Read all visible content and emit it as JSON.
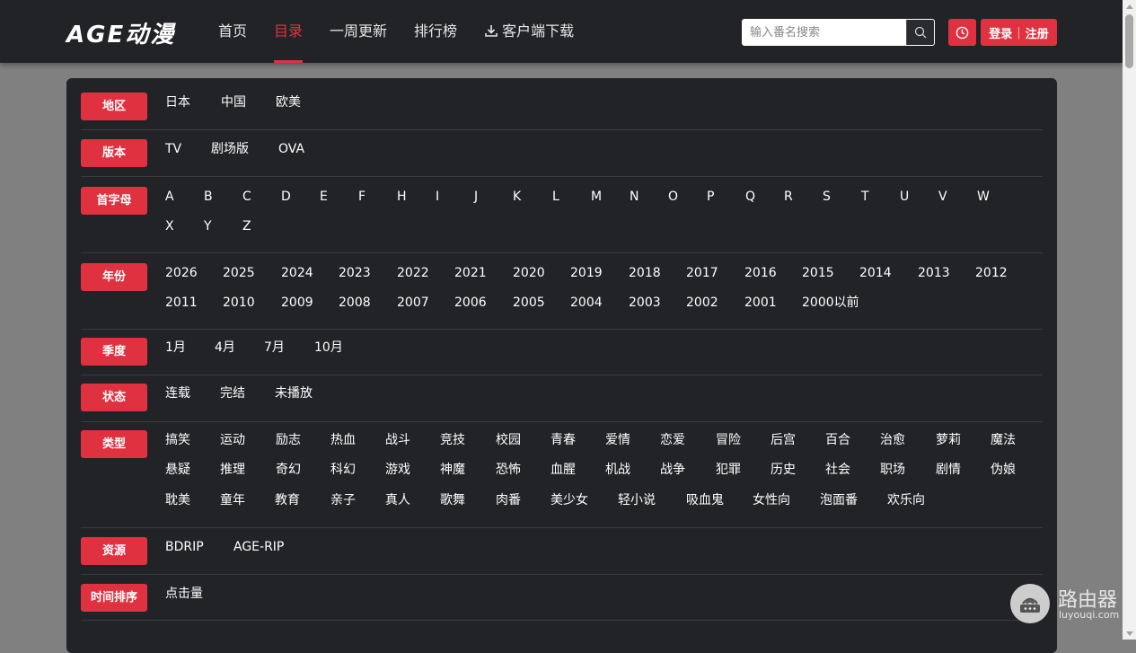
{
  "header": {
    "logo": "AGE动漫",
    "nav": [
      {
        "label": "首页",
        "active": false
      },
      {
        "label": "目录",
        "active": true
      },
      {
        "label": "一周更新",
        "active": false
      },
      {
        "label": "排行榜",
        "active": false
      },
      {
        "label": "客户端下载",
        "active": false
      }
    ],
    "search_placeholder": "输入番名搜索",
    "login_label": "登录",
    "register_label": "注册",
    "accent_color": "#e03141"
  },
  "filters": {
    "region": {
      "label": "地区",
      "items": [
        "日本",
        "中国",
        "欧美"
      ]
    },
    "version": {
      "label": "版本",
      "items": [
        "TV",
        "剧场版",
        "OVA"
      ]
    },
    "letter": {
      "label": "首字母",
      "items": [
        "A",
        "B",
        "C",
        "D",
        "E",
        "F",
        "H",
        "I",
        "J",
        "K",
        "L",
        "M",
        "N",
        "O",
        "P",
        "Q",
        "R",
        "S",
        "T",
        "U",
        "V",
        "W",
        "X",
        "Y",
        "Z"
      ]
    },
    "year": {
      "label": "年份",
      "items": [
        "2026",
        "2025",
        "2024",
        "2023",
        "2022",
        "2021",
        "2020",
        "2019",
        "2018",
        "2017",
        "2016",
        "2015",
        "2014",
        "2013",
        "2012",
        "2011",
        "2010",
        "2009",
        "2008",
        "2007",
        "2006",
        "2005",
        "2004",
        "2003",
        "2002",
        "2001",
        "2000以前"
      ]
    },
    "season": {
      "label": "季度",
      "items": [
        "1月",
        "4月",
        "7月",
        "10月"
      ]
    },
    "status": {
      "label": "状态",
      "items": [
        "连载",
        "完结",
        "未播放"
      ]
    },
    "genre": {
      "label": "类型",
      "items": [
        "搞笑",
        "运动",
        "励志",
        "热血",
        "战斗",
        "竞技",
        "校园",
        "青春",
        "爱情",
        "恋爱",
        "冒险",
        "后宫",
        "百合",
        "治愈",
        "萝莉",
        "魔法",
        "悬疑",
        "推理",
        "奇幻",
        "科幻",
        "游戏",
        "神魔",
        "恐怖",
        "血腥",
        "机战",
        "战争",
        "犯罪",
        "历史",
        "社会",
        "职场",
        "剧情",
        "伪娘",
        "耽美",
        "童年",
        "教育",
        "亲子",
        "真人",
        "歌舞",
        "肉番",
        "美少女",
        "轻小说",
        "吸血鬼",
        "女性向",
        "泡面番",
        "欢乐向"
      ]
    },
    "resource": {
      "label": "资源",
      "items": [
        "BDRIP",
        "AGE-RIP"
      ]
    },
    "sort": {
      "label": "时间排序",
      "items": [
        "点击量"
      ]
    }
  },
  "watermark": {
    "text": "路由器",
    "sub": "luyouqi.com"
  }
}
